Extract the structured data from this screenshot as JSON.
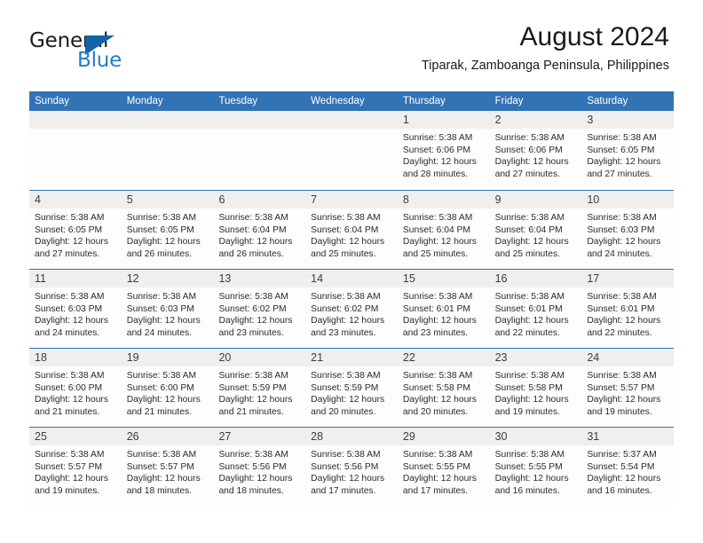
{
  "brand": {
    "name_top": "General",
    "name_bottom": "Blue",
    "triangle_color": "#1263a8",
    "blue_text_color": "#1f7ec4"
  },
  "header": {
    "title": "August 2024",
    "subtitle": "Tiparak, Zamboanga Peninsula, Philippines"
  },
  "theme": {
    "header_blue": "#3273b4",
    "day_band_gray": "#efefef",
    "cell_background": "#fdfdfd"
  },
  "calendar": {
    "weekdays": [
      "Sunday",
      "Monday",
      "Tuesday",
      "Wednesday",
      "Thursday",
      "Friday",
      "Saturday"
    ],
    "weeks": [
      [
        {
          "day": "",
          "lines": []
        },
        {
          "day": "",
          "lines": []
        },
        {
          "day": "",
          "lines": []
        },
        {
          "day": "",
          "lines": []
        },
        {
          "day": "1",
          "lines": [
            "Sunrise: 5:38 AM",
            "Sunset: 6:06 PM",
            "Daylight: 12 hours",
            "and 28 minutes."
          ]
        },
        {
          "day": "2",
          "lines": [
            "Sunrise: 5:38 AM",
            "Sunset: 6:06 PM",
            "Daylight: 12 hours",
            "and 27 minutes."
          ]
        },
        {
          "day": "3",
          "lines": [
            "Sunrise: 5:38 AM",
            "Sunset: 6:05 PM",
            "Daylight: 12 hours",
            "and 27 minutes."
          ]
        }
      ],
      [
        {
          "day": "4",
          "lines": [
            "Sunrise: 5:38 AM",
            "Sunset: 6:05 PM",
            "Daylight: 12 hours",
            "and 27 minutes."
          ]
        },
        {
          "day": "5",
          "lines": [
            "Sunrise: 5:38 AM",
            "Sunset: 6:05 PM",
            "Daylight: 12 hours",
            "and 26 minutes."
          ]
        },
        {
          "day": "6",
          "lines": [
            "Sunrise: 5:38 AM",
            "Sunset: 6:04 PM",
            "Daylight: 12 hours",
            "and 26 minutes."
          ]
        },
        {
          "day": "7",
          "lines": [
            "Sunrise: 5:38 AM",
            "Sunset: 6:04 PM",
            "Daylight: 12 hours",
            "and 25 minutes."
          ]
        },
        {
          "day": "8",
          "lines": [
            "Sunrise: 5:38 AM",
            "Sunset: 6:04 PM",
            "Daylight: 12 hours",
            "and 25 minutes."
          ]
        },
        {
          "day": "9",
          "lines": [
            "Sunrise: 5:38 AM",
            "Sunset: 6:04 PM",
            "Daylight: 12 hours",
            "and 25 minutes."
          ]
        },
        {
          "day": "10",
          "lines": [
            "Sunrise: 5:38 AM",
            "Sunset: 6:03 PM",
            "Daylight: 12 hours",
            "and 24 minutes."
          ]
        }
      ],
      [
        {
          "day": "11",
          "lines": [
            "Sunrise: 5:38 AM",
            "Sunset: 6:03 PM",
            "Daylight: 12 hours",
            "and 24 minutes."
          ]
        },
        {
          "day": "12",
          "lines": [
            "Sunrise: 5:38 AM",
            "Sunset: 6:03 PM",
            "Daylight: 12 hours",
            "and 24 minutes."
          ]
        },
        {
          "day": "13",
          "lines": [
            "Sunrise: 5:38 AM",
            "Sunset: 6:02 PM",
            "Daylight: 12 hours",
            "and 23 minutes."
          ]
        },
        {
          "day": "14",
          "lines": [
            "Sunrise: 5:38 AM",
            "Sunset: 6:02 PM",
            "Daylight: 12 hours",
            "and 23 minutes."
          ]
        },
        {
          "day": "15",
          "lines": [
            "Sunrise: 5:38 AM",
            "Sunset: 6:01 PM",
            "Daylight: 12 hours",
            "and 23 minutes."
          ]
        },
        {
          "day": "16",
          "lines": [
            "Sunrise: 5:38 AM",
            "Sunset: 6:01 PM",
            "Daylight: 12 hours",
            "and 22 minutes."
          ]
        },
        {
          "day": "17",
          "lines": [
            "Sunrise: 5:38 AM",
            "Sunset: 6:01 PM",
            "Daylight: 12 hours",
            "and 22 minutes."
          ]
        }
      ],
      [
        {
          "day": "18",
          "lines": [
            "Sunrise: 5:38 AM",
            "Sunset: 6:00 PM",
            "Daylight: 12 hours",
            "and 21 minutes."
          ]
        },
        {
          "day": "19",
          "lines": [
            "Sunrise: 5:38 AM",
            "Sunset: 6:00 PM",
            "Daylight: 12 hours",
            "and 21 minutes."
          ]
        },
        {
          "day": "20",
          "lines": [
            "Sunrise: 5:38 AM",
            "Sunset: 5:59 PM",
            "Daylight: 12 hours",
            "and 21 minutes."
          ]
        },
        {
          "day": "21",
          "lines": [
            "Sunrise: 5:38 AM",
            "Sunset: 5:59 PM",
            "Daylight: 12 hours",
            "and 20 minutes."
          ]
        },
        {
          "day": "22",
          "lines": [
            "Sunrise: 5:38 AM",
            "Sunset: 5:58 PM",
            "Daylight: 12 hours",
            "and 20 minutes."
          ]
        },
        {
          "day": "23",
          "lines": [
            "Sunrise: 5:38 AM",
            "Sunset: 5:58 PM",
            "Daylight: 12 hours",
            "and 19 minutes."
          ]
        },
        {
          "day": "24",
          "lines": [
            "Sunrise: 5:38 AM",
            "Sunset: 5:57 PM",
            "Daylight: 12 hours",
            "and 19 minutes."
          ]
        }
      ],
      [
        {
          "day": "25",
          "lines": [
            "Sunrise: 5:38 AM",
            "Sunset: 5:57 PM",
            "Daylight: 12 hours",
            "and 19 minutes."
          ]
        },
        {
          "day": "26",
          "lines": [
            "Sunrise: 5:38 AM",
            "Sunset: 5:57 PM",
            "Daylight: 12 hours",
            "and 18 minutes."
          ]
        },
        {
          "day": "27",
          "lines": [
            "Sunrise: 5:38 AM",
            "Sunset: 5:56 PM",
            "Daylight: 12 hours",
            "and 18 minutes."
          ]
        },
        {
          "day": "28",
          "lines": [
            "Sunrise: 5:38 AM",
            "Sunset: 5:56 PM",
            "Daylight: 12 hours",
            "and 17 minutes."
          ]
        },
        {
          "day": "29",
          "lines": [
            "Sunrise: 5:38 AM",
            "Sunset: 5:55 PM",
            "Daylight: 12 hours",
            "and 17 minutes."
          ]
        },
        {
          "day": "30",
          "lines": [
            "Sunrise: 5:38 AM",
            "Sunset: 5:55 PM",
            "Daylight: 12 hours",
            "and 16 minutes."
          ]
        },
        {
          "day": "31",
          "lines": [
            "Sunrise: 5:37 AM",
            "Sunset: 5:54 PM",
            "Daylight: 12 hours",
            "and 16 minutes."
          ]
        }
      ]
    ]
  }
}
